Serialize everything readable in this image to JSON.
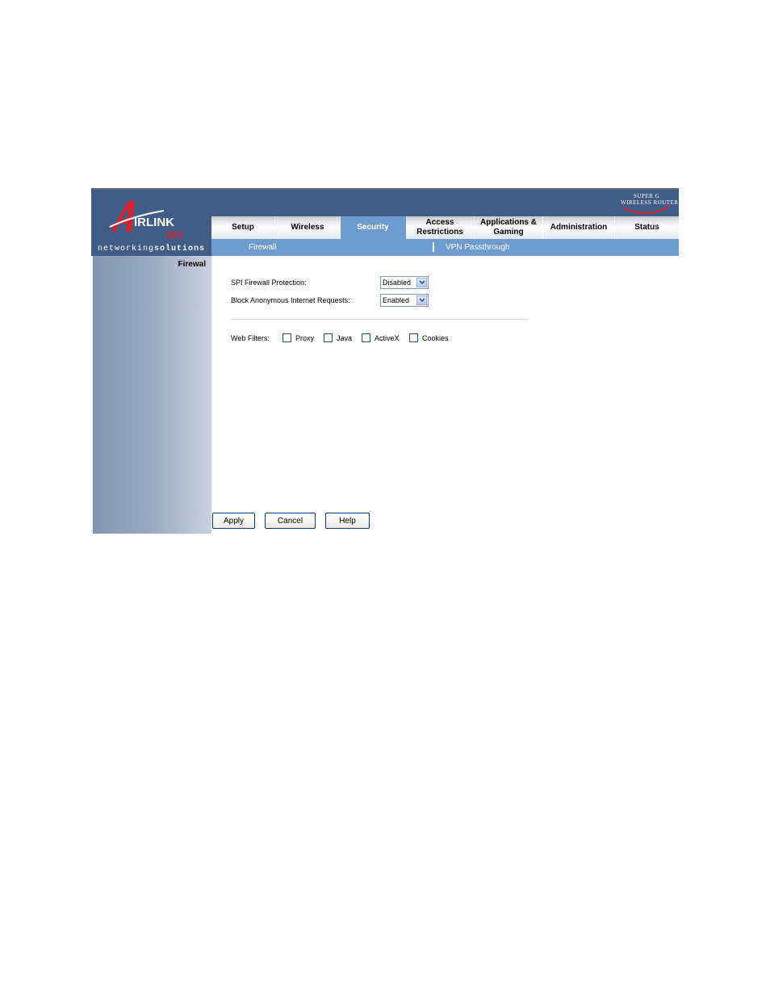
{
  "brand": {
    "logo_text_air": "IRLINK",
    "logo_text_number": "101",
    "tagline_light": "networking",
    "tagline_bold": "solutions",
    "badge_line1": "SUPER G",
    "badge_line2": "WIRELESS ROUTER"
  },
  "tabs": [
    {
      "label": "Setup",
      "active": false
    },
    {
      "label": "Wireless",
      "active": false
    },
    {
      "label": "Security",
      "active": true
    },
    {
      "label": "Access Restrictions",
      "active": false
    },
    {
      "label": "Applications & Gaming",
      "active": false
    },
    {
      "label": "Administration",
      "active": false
    },
    {
      "label": "Status",
      "active": false
    }
  ],
  "subtabs": [
    {
      "label": "Firewall",
      "active": true
    },
    {
      "label": "VPN Passthrough",
      "active": false
    }
  ],
  "sidebar": {
    "section_title": "Firewal"
  },
  "form": {
    "spi_label": "SPI Firewall Protection:",
    "spi_value": "Disabled",
    "block_label": "Block Anonymous Internet Requests:",
    "block_value": "Enabled",
    "web_filters_label": "Web Filters:",
    "filters": [
      {
        "label": "Proxy",
        "checked": false
      },
      {
        "label": "Java",
        "checked": false
      },
      {
        "label": "ActiveX",
        "checked": false
      },
      {
        "label": "Cookies",
        "checked": false
      }
    ]
  },
  "buttons": {
    "apply": "Apply",
    "cancel": "Cancel",
    "help": "Help"
  },
  "colors": {
    "header_blue": "#3f5d86",
    "accent_blue": "#6e9cd0",
    "logo_red": "#d8202a"
  }
}
